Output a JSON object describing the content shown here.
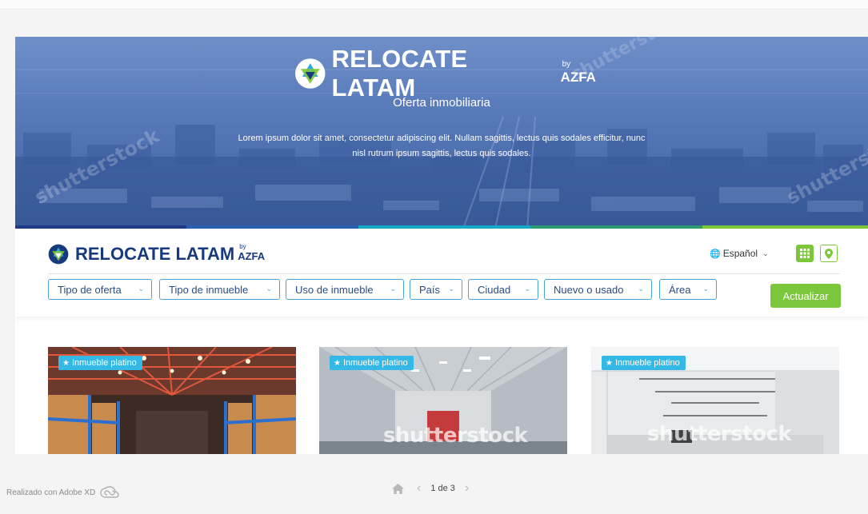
{
  "hero": {
    "brand": "RELOCATE LATAM",
    "by": "by",
    "azfa": "AZFA",
    "subtitle": "Oferta inmobiliaria",
    "description": "Lorem ipsum dolor sit amet, consectetur adipiscing elit. Nullam sagittis, lectus quis sodales efficitur, nunc nisl rutrum ipsum sagittis, lectus quis sodales.",
    "watermark": "shutterstock"
  },
  "nav": {
    "brand": "RELOCATE LATAM",
    "by": "by",
    "azfa": "AZFA",
    "language": "Español",
    "grid_view_icon": "grid-icon",
    "map_view_icon": "map-pin-icon"
  },
  "filters": [
    {
      "label": "Tipo de oferta"
    },
    {
      "label": "Tipo de inmueble"
    },
    {
      "label": "Uso de inmueble"
    },
    {
      "label": "País"
    },
    {
      "label": "Ciudad"
    },
    {
      "label": "Nuevo o usado"
    },
    {
      "label": "Área"
    }
  ],
  "update_label": "Actualizar",
  "cards": [
    {
      "badge": "Inmueble platino",
      "watermark": ""
    },
    {
      "badge": "Inmueble platino",
      "watermark": "shutterstock"
    },
    {
      "badge": "Inmueble platino",
      "watermark": "shutterstock"
    }
  ],
  "footer": {
    "credit": "Realizado con Adobe XD",
    "page": "1 de 3"
  },
  "colors": {
    "brand_navy": "#173a7e",
    "accent_green": "#7cc63b",
    "badge_blue": "#34b9e6",
    "filter_border": "#4aa3d9"
  }
}
